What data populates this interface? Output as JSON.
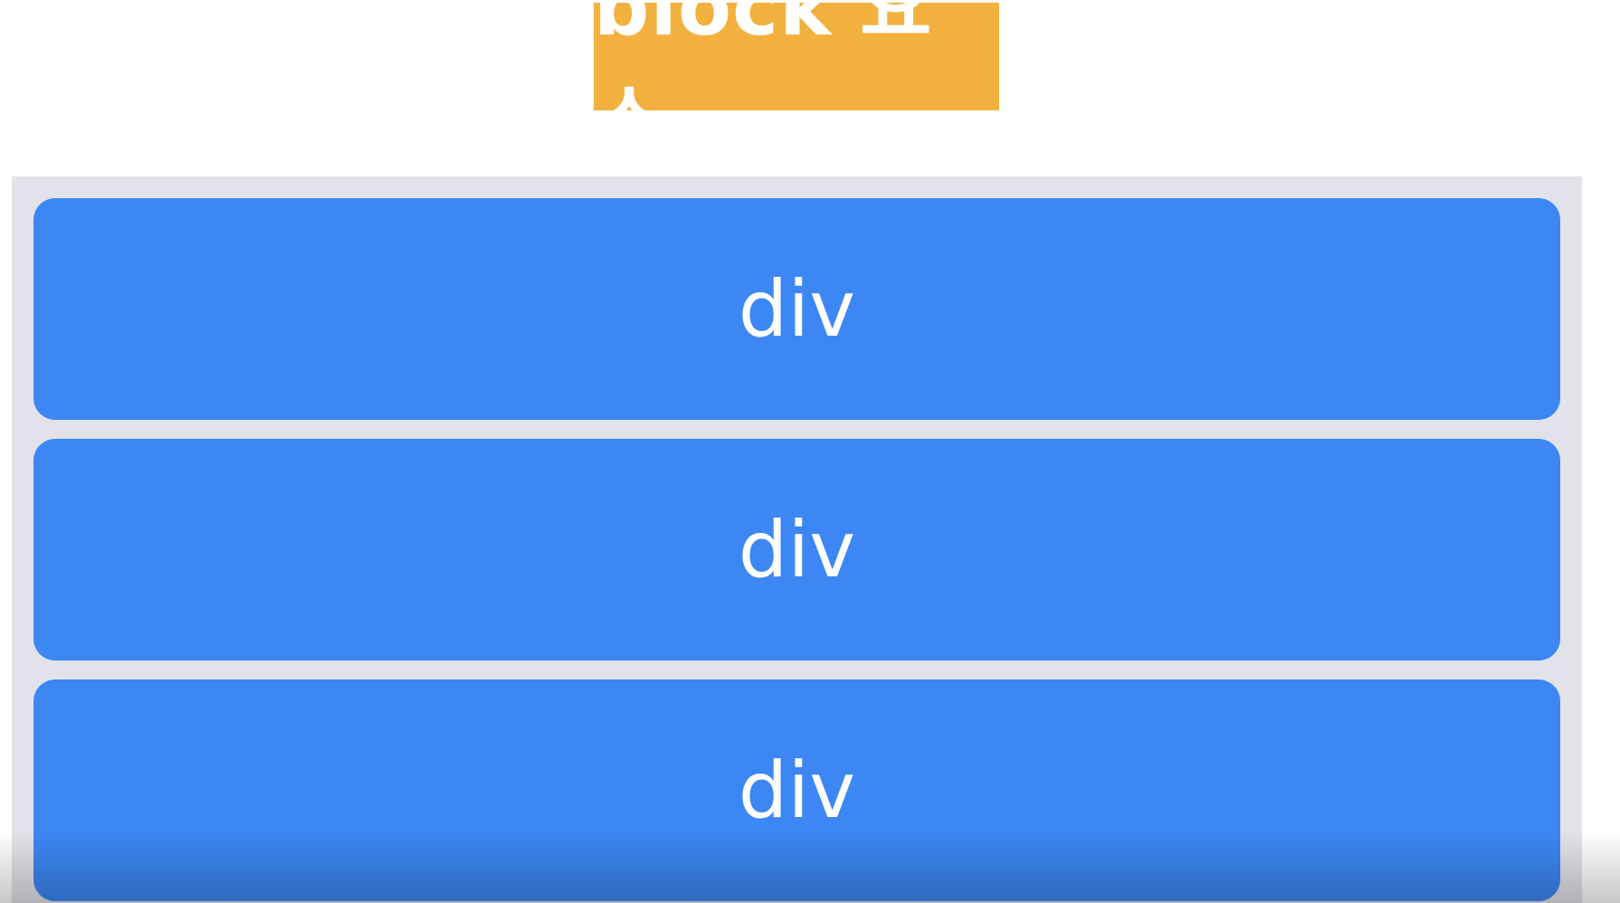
{
  "title": "block 요소",
  "blocks": [
    "div",
    "div",
    "div"
  ],
  "colors": {
    "title_bg": "#f2b13f",
    "container_bg": "#e2e2ea",
    "block_bg": "#3c87f3",
    "text": "#ffffff"
  }
}
